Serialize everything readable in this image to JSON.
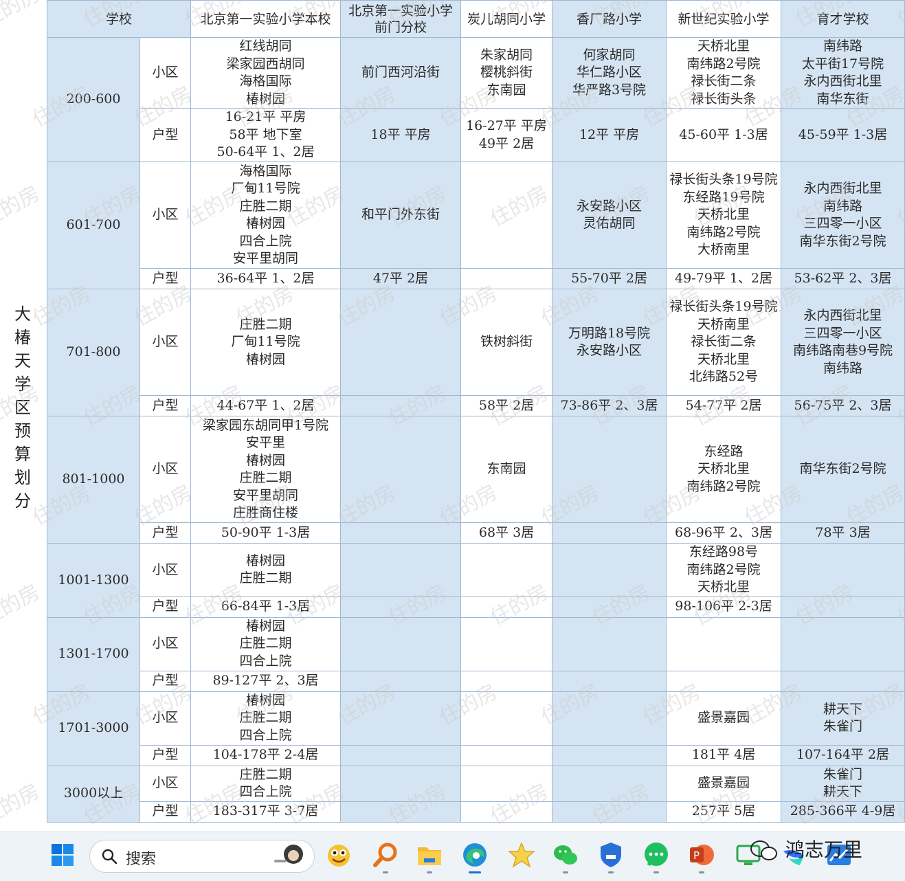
{
  "side_title": "大椿天学区预算划分",
  "headers": [
    "学校",
    "北京第一实验小学本校",
    "北京第一实验小学前门分校",
    "炭儿胡同小学",
    "香厂路小学",
    "新世纪实验小学",
    "育才学校"
  ],
  "watermark_text": "住的房",
  "rows": [
    {
      "range": "200-600",
      "xq_label": "小区",
      "hx_label": "户型",
      "xq": [
        "红线胡同\n梁家园西胡同\n海格国际\n椿树园",
        "前门西河沿街",
        "朱家胡同\n樱桃斜街\n东南园",
        "何家胡同\n华仁路小区\n华严路3号院",
        "天桥北里\n南纬路2号院\n禄长街二条\n禄长街头条",
        "南纬路\n太平街17号院\n永内西街北里\n南华东街"
      ],
      "hx": [
        "16-21平 平房\n58平 地下室\n50-64平 1、2居",
        "18平 平房",
        "16-27平 平房\n49平 2居",
        "12平 平房",
        "45-60平 1-3居",
        "45-59平 1-3居"
      ]
    },
    {
      "range": "601-700",
      "xq_label": "小区",
      "hx_label": "户型",
      "xq": [
        "海格国际\n厂甸11号院\n庄胜二期\n椿树园\n四合上院\n安平里胡同",
        "和平门外东街",
        "",
        "永安路小区\n灵佑胡同",
        "禄长街头条19号院\n东经路19号院\n天桥北里\n南纬路2号院\n大桥南里",
        "永内西街北里\n南纬路\n三四零一小区\n南华东街2号院"
      ],
      "hx": [
        "36-64平 1、2居",
        "47平 2居",
        "",
        "55-70平 2居",
        "49-79平 1、2居",
        "53-62平 2、3居"
      ]
    },
    {
      "range": "701-800",
      "xq_label": "小区",
      "hx_label": "户型",
      "xq": [
        "庄胜二期\n厂甸11号院\n椿树园",
        "",
        "铁树斜街",
        "万明路18号院\n永安路小区",
        "禄长街头条19号院\n天桥南里\n禄长街二条\n天桥北里\n北纬路52号",
        "永内西街北里\n三四零一小区\n南纬路南巷9号院\n南纬路"
      ],
      "hx": [
        "44-67平 1、2居",
        "",
        "58平 2居",
        "73-86平 2、3居",
        "54-77平 2居",
        "56-75平 2、3居"
      ]
    },
    {
      "range": "801-1000",
      "xq_label": "小区",
      "hx_label": "户型",
      "xq": [
        "梁家园东胡同甲1号院\n安平里\n椿树园\n庄胜二期\n安平里胡同\n庄胜商住楼",
        "",
        "东南园",
        "",
        "东经路\n天桥北里\n南纬路2号院",
        "南华东街2号院"
      ],
      "hx": [
        "50-90平 1-3居",
        "",
        "68平 3居",
        "",
        "68-96平 2、3居",
        "78平 3居"
      ]
    },
    {
      "range": "1001-1300",
      "xq_label": "小区",
      "hx_label": "户型",
      "xq": [
        "椿树园\n庄胜二期",
        "",
        "",
        "",
        "东经路98号\n南纬路2号院\n天桥北里",
        ""
      ],
      "hx": [
        "66-84平 1-3居",
        "",
        "",
        "",
        "98-106平 2-3居",
        ""
      ]
    },
    {
      "range": "1301-1700",
      "xq_label": "小区",
      "hx_label": "户型",
      "xq": [
        "椿树园\n庄胜二期\n四合上院",
        "",
        "",
        "",
        "",
        ""
      ],
      "hx": [
        "89-127平 2、3居",
        "",
        "",
        "",
        "",
        ""
      ]
    },
    {
      "range": "1701-3000",
      "xq_label": "小区",
      "hx_label": "户型",
      "xq": [
        "椿树园\n庄胜二期\n四合上院",
        "",
        "",
        "",
        "盛景嘉园",
        "耕天下\n朱雀门"
      ],
      "hx": [
        "104-178平 2-4居",
        "",
        "",
        "",
        "181平 4居",
        "107-164平 2居"
      ]
    },
    {
      "range": "3000以上",
      "xq_label": "小区",
      "hx_label": "户型",
      "xq": [
        "庄胜二期\n四合上院",
        "",
        "",
        "",
        "盛景嘉园",
        "朱雀门\n耕天下"
      ],
      "hx": [
        "183-317平 3-7居",
        "",
        "",
        "",
        "257平 5居",
        "285-366平 4-9居"
      ]
    }
  ],
  "taskbar": {
    "search_placeholder": "搜索",
    "wechat_account": "鸿志万里",
    "apps": [
      "windows-start",
      "search",
      "emoji-app",
      "magnifier-app",
      "file-explorer",
      "edge-browser",
      "star-app",
      "wechat",
      "shield-app",
      "chat-app",
      "powerpoint",
      "screen-app",
      "feishu",
      "stock-app"
    ]
  },
  "colors": {
    "header_bg": "#d5e4f2",
    "alt_col_bg": "#d5e4f2",
    "border": "#9db8d2"
  }
}
